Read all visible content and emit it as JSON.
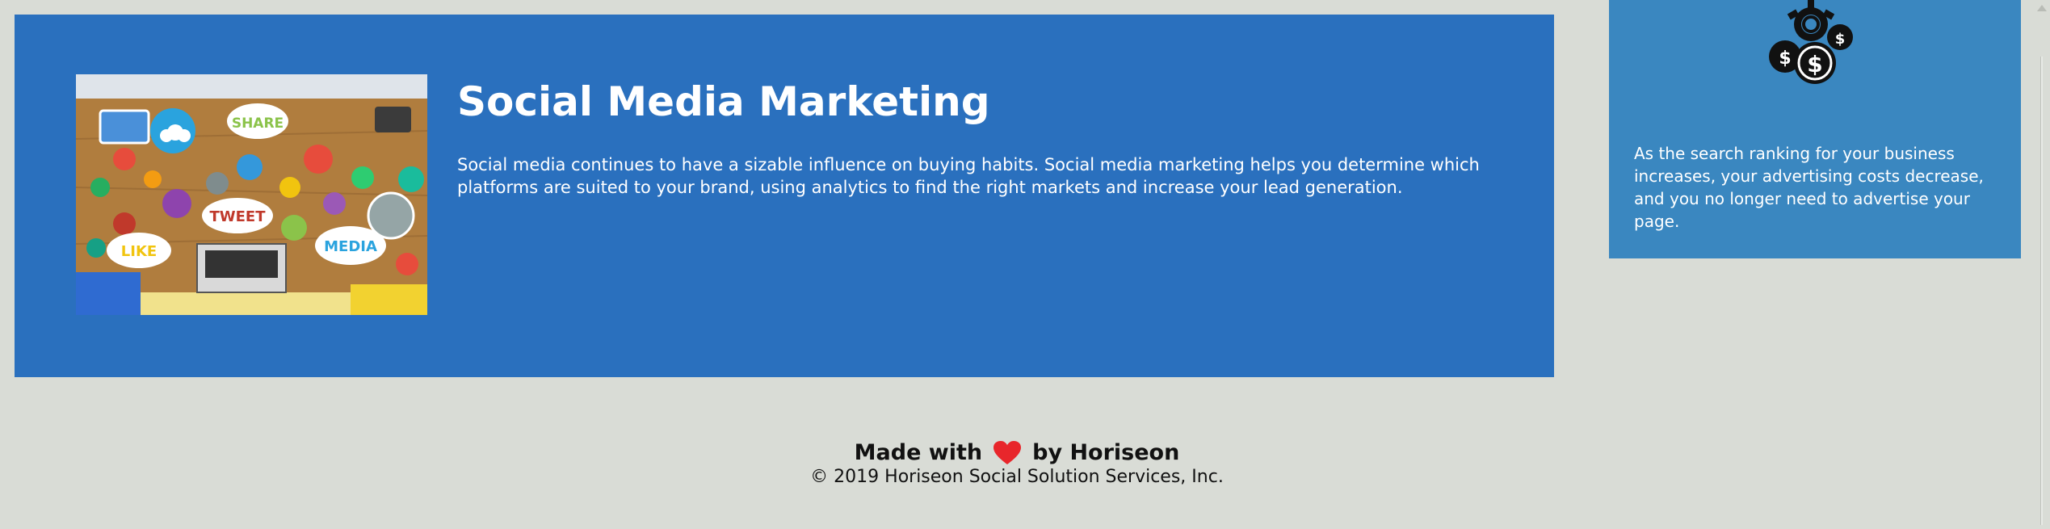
{
  "main": {
    "title": "Social Media Marketing",
    "body": "Social media continues to have a sizable influence on buying habits. Social media marketing helps you determine which platforms are suited to your brand, using analytics to find the right markets and increase your lead generation.",
    "image": {
      "icon": "social-media-collage-image",
      "bubbles": [
        "SHARE",
        "TWEET",
        "LIKE",
        "MEDIA"
      ]
    }
  },
  "sidebar": {
    "icon": "money-gear-icon",
    "text": "As the search ranking for your business increases, your advertising costs decrease, and you no longer need to advertise your page."
  },
  "footer": {
    "made_prefix": "Made with",
    "made_suffix": "by Horiseon",
    "copyright": "© 2019 Horiseon Social Solution Services, Inc."
  },
  "colors": {
    "background": "#d9dcd6",
    "card": "#2a70be",
    "sidebar": "#3a87c0",
    "heart": "#e8262b"
  }
}
